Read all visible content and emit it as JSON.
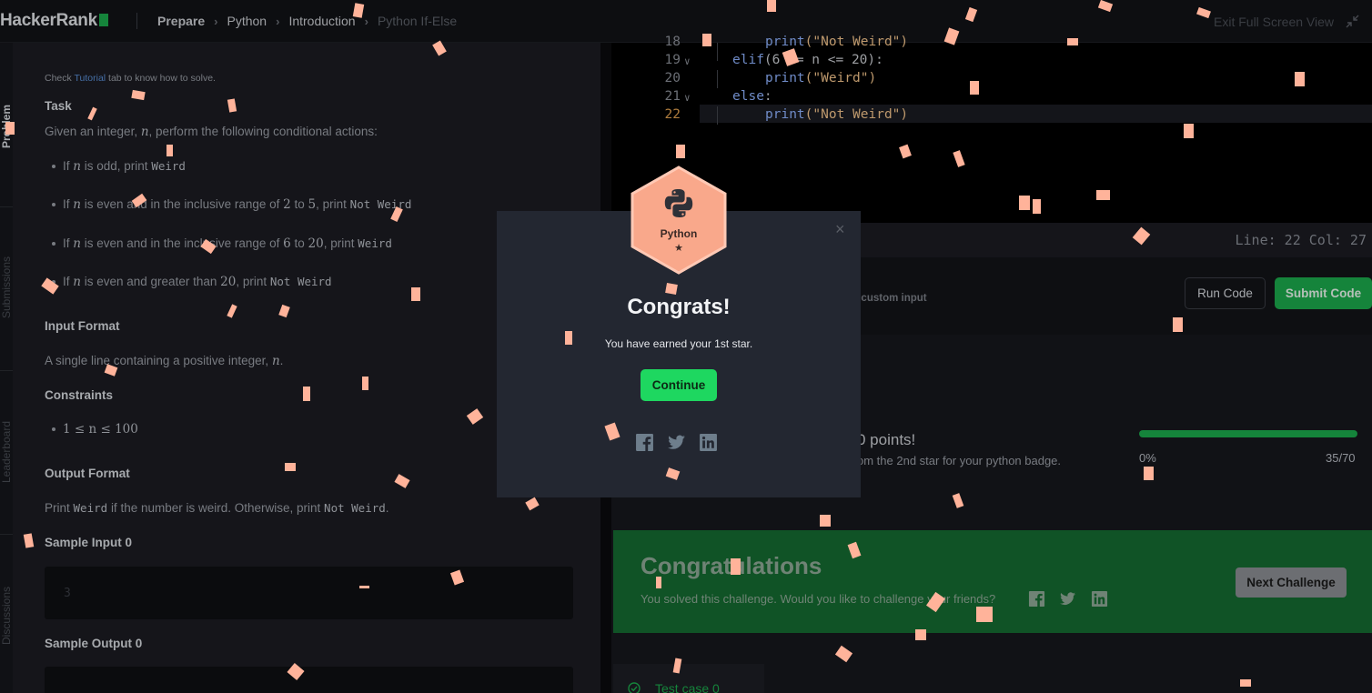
{
  "topbar": {
    "logo": "HackerRank",
    "breadcrumb": [
      "Prepare",
      "Python",
      "Introduction",
      "Python If-Else"
    ],
    "exit_fullscreen": "Exit Full Screen View"
  },
  "sidetabs": [
    "Problem",
    "Submissions",
    "Leaderboard",
    "Discussions"
  ],
  "problem": {
    "check_prefix": "Check",
    "check_link": "Tutorial",
    "check_suffix": "tab to know how to solve.",
    "task_heading": "Task",
    "intro_a": "Given an integer,",
    "intro_var": "n",
    "intro_b": ", perform the following conditional actions:",
    "rules": [
      {
        "a": "If",
        "v": "n",
        "b": "is odd, print",
        "code": "Weird"
      },
      {
        "a": "If",
        "v": "n",
        "b": "is even and in the inclusive range of",
        "r1": "2",
        "mid": "to",
        "r2": "5",
        "c": ", print",
        "code": "Not Weird"
      },
      {
        "a": "If",
        "v": "n",
        "b": "is even and in the inclusive range of",
        "r1": "6",
        "mid": "to",
        "r2": "20",
        "c": ", print",
        "code": "Weird"
      },
      {
        "a": "If",
        "v": "n",
        "b": "is even and greater than",
        "r1": "20",
        "c": ", print",
        "code": "Not Weird"
      }
    ],
    "input_heading": "Input Format",
    "input_text_a": "A single line containing a positive integer,",
    "input_text_var": "n",
    "input_text_b": ".",
    "constraints_heading": "Constraints",
    "constraint": "1 ≤ n ≤ 100",
    "output_heading": "Output Format",
    "output_a": "Print",
    "output_code1": "Weird",
    "output_b": "if the number is weird. Otherwise, print",
    "output_code2": "Not Weird",
    "output_c": ".",
    "sample_input_heading": "Sample Input 0",
    "sample_input_value": "3",
    "sample_output_heading": "Sample Output 0"
  },
  "editor": {
    "lines": [
      {
        "no": "18",
        "fold": false
      },
      {
        "no": "19",
        "fold": true
      },
      {
        "no": "20",
        "fold": false
      },
      {
        "no": "21",
        "fold": true
      },
      {
        "no": "22",
        "fold": false
      }
    ],
    "code_18_fn": "print",
    "code_18_str": "(\"Not Weird\")",
    "code_19_kw": "elif",
    "code_19_rest": "(6 <= n <= 20):",
    "code_20_fn": "print",
    "code_20_str": "(\"Weird\")",
    "code_21_kw": "else",
    "code_21_rest": ":",
    "code_22_fn": "print",
    "code_22_str": "(\"Not Weird\")",
    "line_col": "Line: 22  Col: 27"
  },
  "actions": {
    "custom_input": "st custom input",
    "run": "Run Code",
    "submit": "Submit Code"
  },
  "results": {
    "points": "0 points!",
    "badge_msg": "om the 2nd star for your python badge.",
    "progress_pct": "0%",
    "progress_count": "35/70",
    "progress_fraction": 1.0
  },
  "banner": {
    "title": "Congratulations",
    "subtitle": "You solved this challenge. Would you like to challenge your friends?",
    "next": "Next Challenge"
  },
  "testcase": {
    "label": "Test case 0"
  },
  "modal": {
    "badge_name": "Python",
    "badge_star": "★",
    "title": "Congrats!",
    "subtitle": "You have earned your 1st star.",
    "continue": "Continue",
    "close": "×"
  },
  "colors": {
    "accent_green": "#1ba94c",
    "continue_green": "#1ed760",
    "badge": "#f9a88b",
    "confetti": "#ffb39a"
  },
  "icons": [
    "python-icon",
    "facebook-icon",
    "twitter-icon",
    "linkedin-icon",
    "collapse-icon",
    "check-icon",
    "close-icon"
  ]
}
